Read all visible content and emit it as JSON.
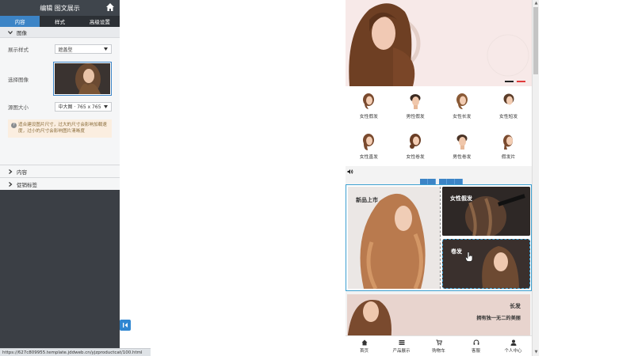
{
  "editor": {
    "title": "编辑 图文展示",
    "tabs": [
      {
        "label": "内容"
      },
      {
        "label": "样式"
      },
      {
        "label": "高级设置"
      }
    ],
    "image_section": {
      "title": "图像",
      "display_style_label": "展示样式",
      "display_style_value": "遮盖型",
      "select_image_label": "选择图像",
      "source_size_label": "源图大小",
      "source_size_value": "中大图 · 765 x 765",
      "note": "适合建设图片尺寸，过大的尺寸会影响加载速度，过小的尺寸会影响图片清晰度"
    },
    "content_section": "内容",
    "promo_section": "促销标签"
  },
  "status_url": "https://627c809955.template.jddweb.cn/yjzproductcat/100.html",
  "preview": {
    "categories": [
      {
        "label": "女性假发",
        "icon": "female-head-icon"
      },
      {
        "label": "男性假发",
        "icon": "male-head-icon"
      },
      {
        "label": "女性长发",
        "icon": "female-head-icon"
      },
      {
        "label": "女性短发",
        "icon": "female-head-icon"
      },
      {
        "label": "女性直发",
        "icon": "female-head-icon"
      },
      {
        "label": "女性卷发",
        "icon": "female-head-icon"
      },
      {
        "label": "男性卷发",
        "icon": "male-head-icon"
      },
      {
        "label": "假发片",
        "icon": "female-head-icon"
      }
    ],
    "module": {
      "left_title": "新品上市",
      "right_top_title": "女性假发",
      "right_bottom_title": "卷发"
    },
    "strip": {
      "title": "长发",
      "subtitle": "拥有独一无二的美丽"
    },
    "bottom_nav": [
      {
        "label": "首页",
        "icon": "home-icon"
      },
      {
        "label": "产品展示",
        "icon": "list-icon"
      },
      {
        "label": "购物车",
        "icon": "cart-icon"
      },
      {
        "label": "客服",
        "icon": "headset-icon"
      },
      {
        "label": "个人中心",
        "icon": "user-icon"
      }
    ]
  },
  "colors": {
    "accent": "#3c84c6",
    "panel_dark": "#3b3f45",
    "note_bg": "#fbeee0"
  }
}
